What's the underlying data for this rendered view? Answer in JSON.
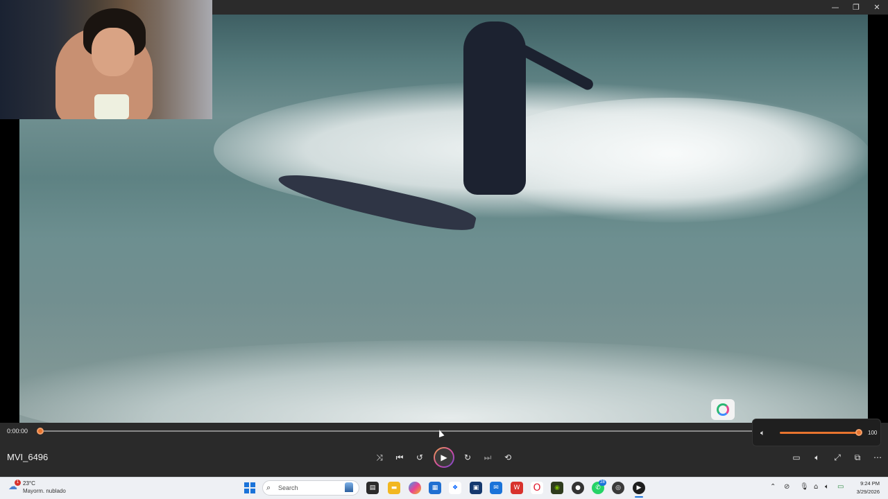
{
  "window": {
    "minimize_icon": "minimize-icon",
    "maximize_icon": "restore-icon",
    "close_icon": "close-icon"
  },
  "player": {
    "current_time": "0:00:00",
    "title": "MVI_6496",
    "progress_fraction": 0.0,
    "volume_value": "100",
    "volume_fraction": 1.0,
    "accent_color": "#e8742e",
    "icons": [
      "shuffle-icon",
      "previous-icon",
      "rewind-10-icon",
      "play-icon",
      "forward-30-icon",
      "next-icon",
      "repeat-off-icon",
      "volume-icon",
      "miniplayer-icon",
      "volume-icon",
      "fullscreen-icon",
      "cast-icon",
      "more-icon"
    ]
  },
  "taskbar": {
    "weather": {
      "temperature": "23°C",
      "description": "Mayorm. nublado",
      "badge": "1"
    },
    "search_placeholder": "Search",
    "apps": [
      "task-view-icon",
      "file-explorer-icon",
      "copilot-icon",
      "store-icon",
      "dropbox-icon",
      "terminal-icon",
      "outlook-icon",
      "wps-icon",
      "opera-icon",
      "nvidia-icon",
      "chrome-icon",
      "whatsapp-icon",
      "obs-icon",
      "media-player-icon"
    ],
    "whatsapp_badge": "28",
    "clock": {
      "time": "9:24 PM",
      "date": "3/29/2026"
    }
  }
}
